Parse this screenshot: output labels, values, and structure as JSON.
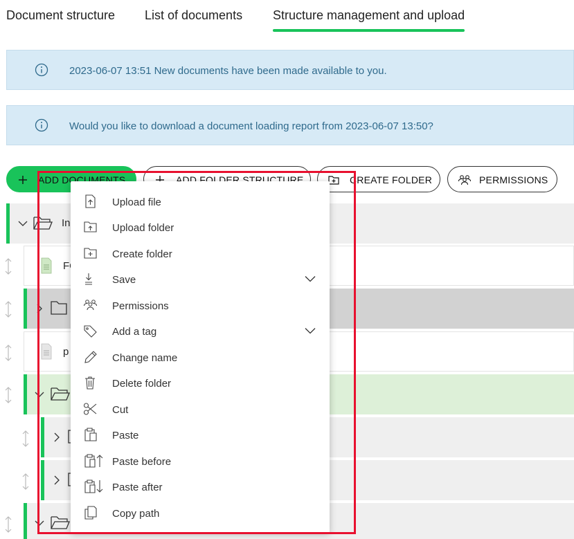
{
  "tabs": [
    {
      "label": "Document structure"
    },
    {
      "label": "List of documents"
    },
    {
      "label": "Structure management and upload"
    }
  ],
  "alerts": [
    {
      "text": "2023-06-07 13:51 New documents have been made available to you."
    },
    {
      "text": "Would you like to download a document loading report from 2023-06-07 13:50?"
    }
  ],
  "toolbar": {
    "add_documents": "ADD DOCUMENTS",
    "add_folder_structure": "ADD FOLDER STRUCTURE",
    "create_folder": "CREATE FOLDER",
    "permissions": "PERMISSIONS"
  },
  "tree": {
    "row1_label": "In",
    "row2_label": "FO",
    "row4_label": "p"
  },
  "menu": {
    "items": [
      {
        "label": "Upload file",
        "icon": "upload-file-icon"
      },
      {
        "label": "Upload folder",
        "icon": "upload-folder-icon"
      },
      {
        "label": "Create folder",
        "icon": "create-folder-icon"
      },
      {
        "label": "Save",
        "icon": "save-icon"
      },
      {
        "label": "Permissions",
        "icon": "permissions-icon"
      },
      {
        "label": "Add a tag",
        "icon": "tag-icon"
      },
      {
        "label": "Change name",
        "icon": "pencil-icon"
      },
      {
        "label": "Delete folder",
        "icon": "trash-icon"
      },
      {
        "label": "Cut",
        "icon": "scissors-icon"
      },
      {
        "label": "Paste",
        "icon": "paste-icon"
      },
      {
        "label": "Paste before",
        "icon": "paste-before-icon"
      },
      {
        "label": "Paste after",
        "icon": "paste-after-icon"
      },
      {
        "label": "Copy path",
        "icon": "copy-path-icon"
      }
    ]
  },
  "colors": {
    "accent": "#19c35a",
    "highlight": "#e8102f",
    "alert_bg": "#d7eaf6"
  }
}
